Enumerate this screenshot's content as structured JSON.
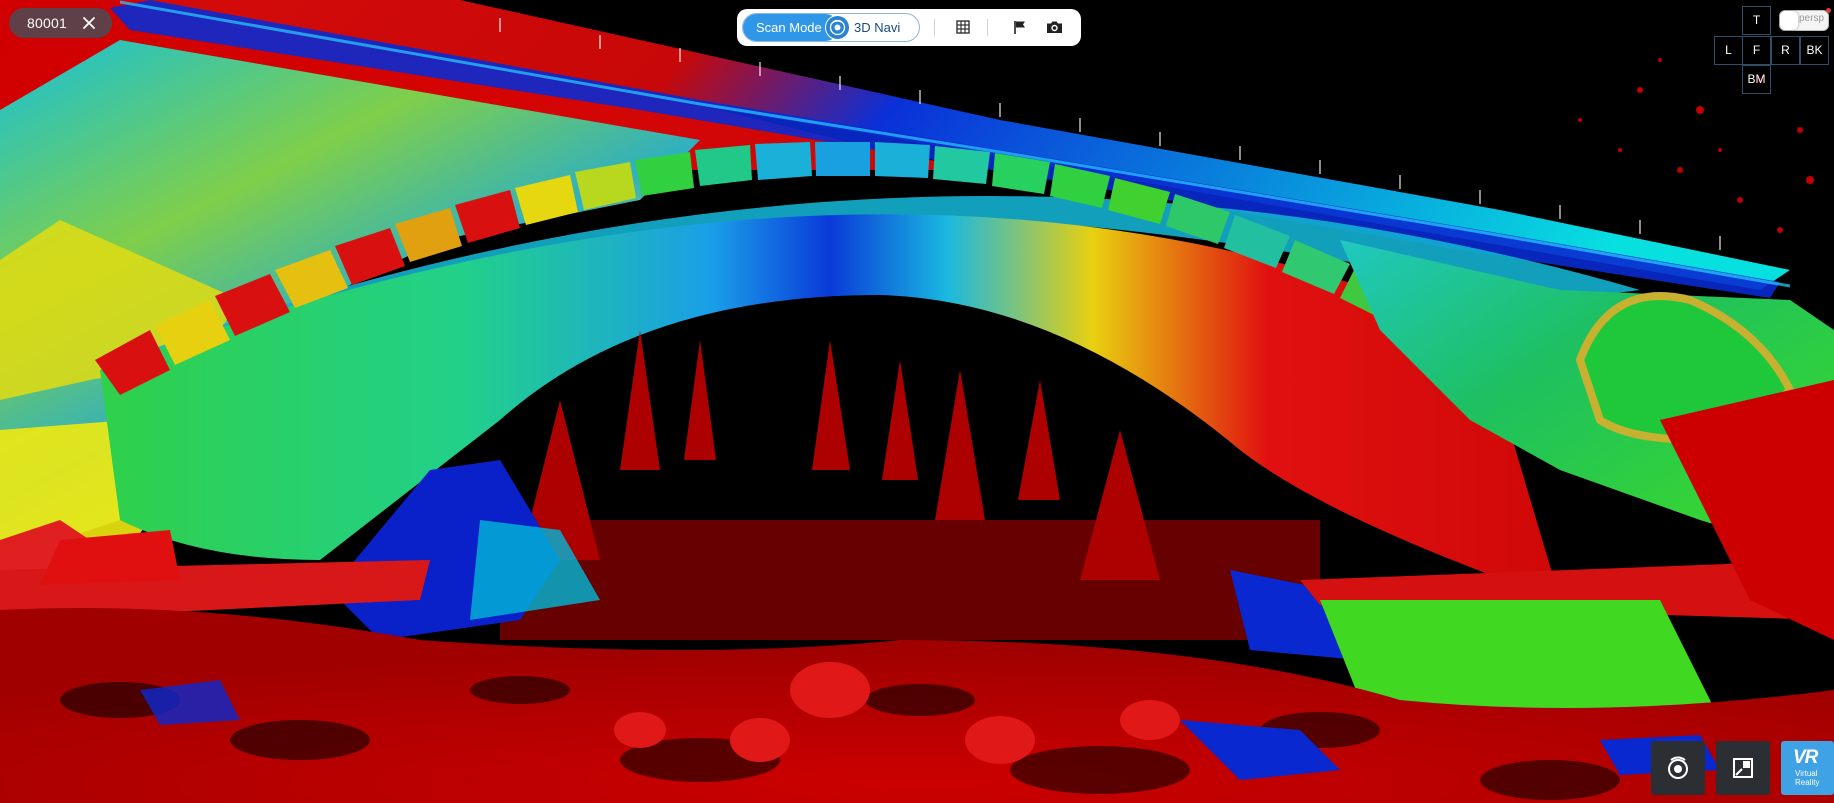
{
  "scan": {
    "id": "80001",
    "close_icon": "close-icon"
  },
  "toolbar": {
    "modes": {
      "active": "Scan Mode",
      "inactive": "3D Navi"
    },
    "icons": [
      "grid-icon",
      "flag-icon",
      "camera-icon"
    ]
  },
  "view_cube": {
    "top": "T",
    "left": "L",
    "front": "F",
    "right": "R",
    "back": "BK",
    "bottom": "BM",
    "projection": "persp"
  },
  "bottom_tools": {
    "icons": [
      "measure-icon",
      "window-icon"
    ],
    "vr": {
      "big": "VR",
      "label": "Virtual Reality"
    }
  },
  "scene": {
    "subject": "point-cloud-bridge",
    "colors": {
      "accent": "#2f96e8",
      "red": "#d00000",
      "yellow": "#e6e000",
      "green": "#22cc22",
      "cyan": "#18b8c8",
      "blue": "#0a28c8"
    }
  }
}
